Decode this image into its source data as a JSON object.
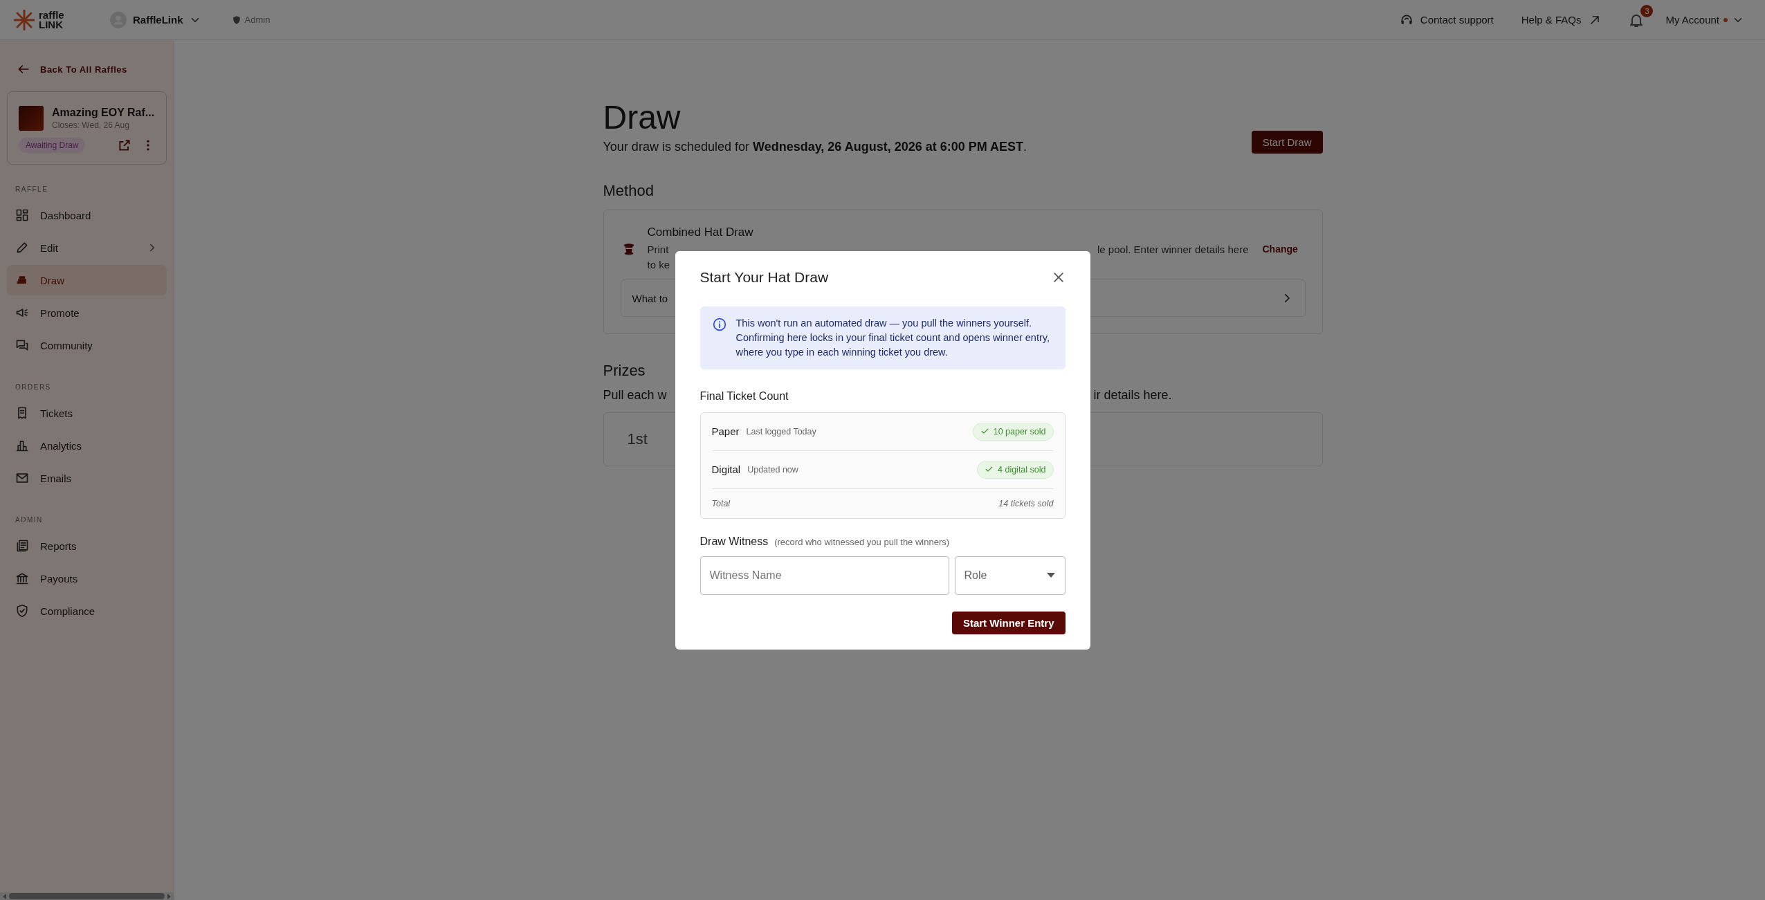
{
  "header": {
    "logo": {
      "line1": "raffle",
      "line2": "LINK"
    },
    "org": "RaffleLink",
    "role": "Admin",
    "contact": "Contact support",
    "help": "Help & FAQs",
    "notifications": {
      "count": "3"
    },
    "account": {
      "label": "My Account",
      "alert": true
    }
  },
  "sidebar": {
    "back_link": "Back To All Raffles",
    "raffle_card": {
      "title": "Amazing EOY Raf...",
      "closes": "Closes: Wed, 26 Aug",
      "status": "Awaiting Draw"
    },
    "sections": [
      {
        "label": "RAFFLE",
        "items": [
          {
            "label": "Dashboard",
            "selected": false,
            "expandable": false
          },
          {
            "label": "Edit",
            "selected": false,
            "expandable": true
          },
          {
            "label": "Draw",
            "selected": true,
            "expandable": false
          },
          {
            "label": "Promote",
            "selected": false,
            "expandable": false
          },
          {
            "label": "Community",
            "selected": false,
            "expandable": false
          }
        ]
      },
      {
        "label": "ORDERS",
        "items": [
          {
            "label": "Tickets",
            "selected": false,
            "expandable": false
          },
          {
            "label": "Analytics",
            "selected": false,
            "expandable": false
          },
          {
            "label": "Emails",
            "selected": false,
            "expandable": false
          }
        ]
      },
      {
        "label": "ADMIN",
        "items": [
          {
            "label": "Reports",
            "selected": false,
            "expandable": false
          },
          {
            "label": "Payouts",
            "selected": false,
            "expandable": false
          },
          {
            "label": "Compliance",
            "selected": false,
            "expandable": false
          }
        ]
      }
    ]
  },
  "main": {
    "title": "Draw",
    "schedule": "Your draw is scheduled for **Wednesday, 26 August, 2026 at 6:00 PM AEST**.",
    "start_button": "Start Draw",
    "method": {
      "heading": "Method",
      "name": "Combined Hat Draw",
      "description_line1_left": "Print",
      "description_line1_right": "le pool. Enter winner details here",
      "description_line2_left": "to ke",
      "change": "Change",
      "expander_left": "What to"
    },
    "prizes": {
      "heading": "Prizes",
      "intro_left": "Pull each w",
      "intro_right": "ir details here.",
      "first_rank": "1st"
    }
  },
  "modal": {
    "title": "Start Your Hat Draw",
    "info": "This won't run an automated draw — you pull the winners yourself. Confirming here locks in your final ticket count and opens winner entry, where you type in each winning ticket you drew.",
    "ticket_heading": "Final Ticket Count",
    "rows": [
      {
        "label": "Paper",
        "note": "Last logged Today",
        "badge": "10 paper sold",
        "verified": true
      },
      {
        "label": "Digital",
        "note": "Updated now",
        "badge": "4 digital sold",
        "verified": true
      }
    ],
    "total": {
      "label": "Total",
      "value": "14 tickets sold"
    },
    "witness": {
      "heading": "Draw Witness",
      "hint": "(record who witnessed you pull the winners)",
      "name_placeholder": "Witness Name",
      "role_placeholder": "Role"
    },
    "submit": "Start Winner Entry"
  }
}
